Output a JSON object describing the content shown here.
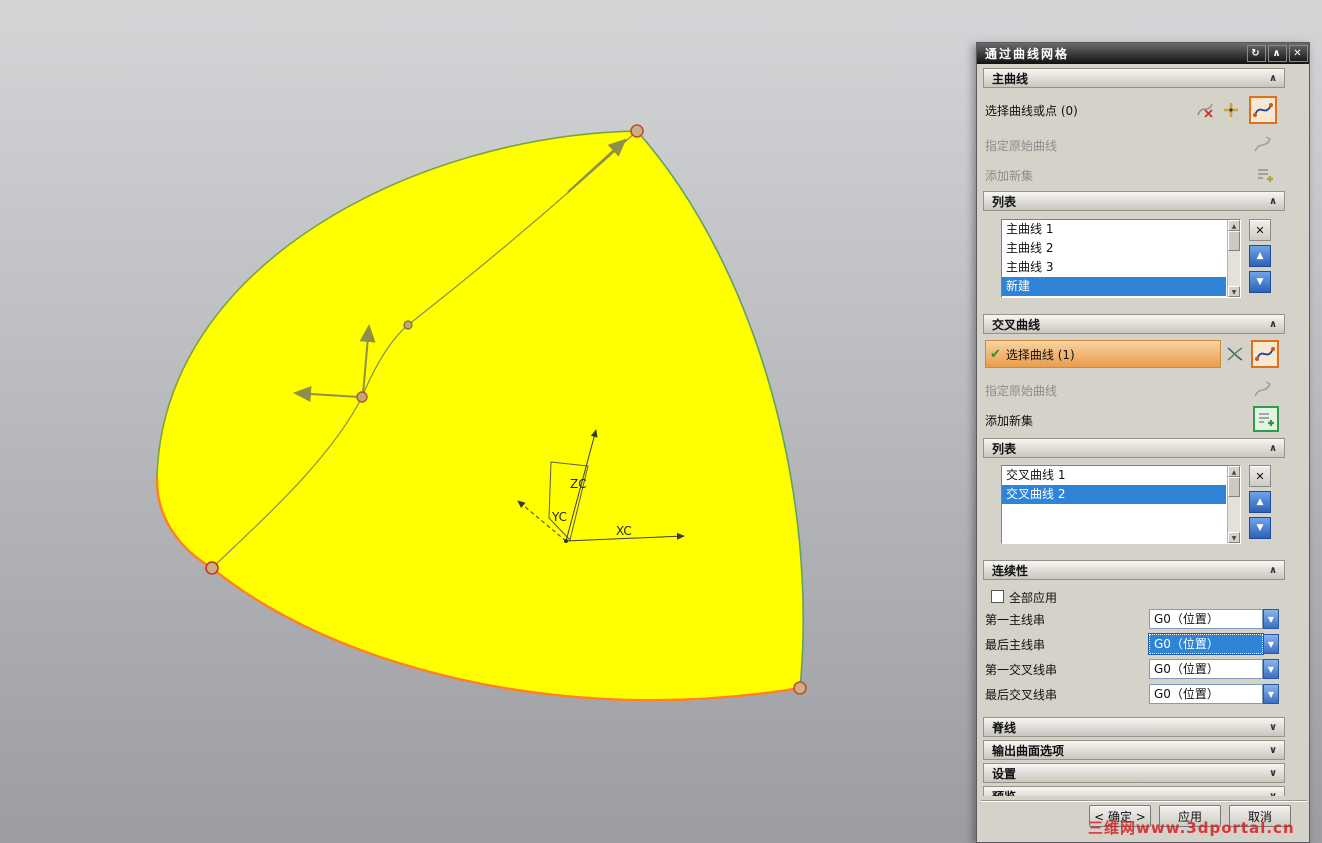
{
  "title_bar": {
    "title": "通过曲线网格"
  },
  "icons": {
    "reset": "↻",
    "collapse": "∧",
    "close": "✕",
    "chevron_up": "∧",
    "chevron_down": "∨",
    "check": "✔",
    "remove": "✕",
    "move_up": "▲",
    "move_down": "▼",
    "dropdown": "▼",
    "scroll_up": "▲",
    "scroll_down": "▼"
  },
  "primary_section": {
    "header": "主曲线",
    "select_row": "选择曲线或点 (0)",
    "origin_row": "指定原始曲线",
    "add_set_row": "添加新集",
    "list_header": "列表",
    "items": [
      "主曲线 1",
      "主曲线 2",
      "主曲线 3"
    ],
    "new_item": "新建"
  },
  "cross_section": {
    "header": "交叉曲线",
    "select_row": "选择曲线 (1)",
    "origin_row": "指定原始曲线",
    "add_set_row": "添加新集",
    "list_header": "列表",
    "items": [
      "交叉曲线 1",
      "交叉曲线 2"
    ]
  },
  "continuity_section": {
    "header": "连续性",
    "apply_all": "全部应用",
    "rows": [
      {
        "label": "第一主线串",
        "value": "G0（位置）"
      },
      {
        "label": "最后主线串",
        "value": "G0（位置）"
      },
      {
        "label": "第一交叉线串",
        "value": "G0（位置）"
      },
      {
        "label": "最后交叉线串",
        "value": "G0（位置）"
      }
    ]
  },
  "collapsed_sections": [
    {
      "label": "脊线"
    },
    {
      "label": "输出曲面选项"
    },
    {
      "label": "设置"
    },
    {
      "label": "预览"
    }
  ],
  "footer": {
    "ok": "< 确定 >",
    "apply": "应用",
    "cancel": "取消"
  },
  "viewport": {
    "surface_color": "#ffff00",
    "axis_labels": {
      "zc": "ZC",
      "yc": "YC",
      "xc": "XC"
    }
  },
  "watermark": "三维网www.3dportal.cn"
}
